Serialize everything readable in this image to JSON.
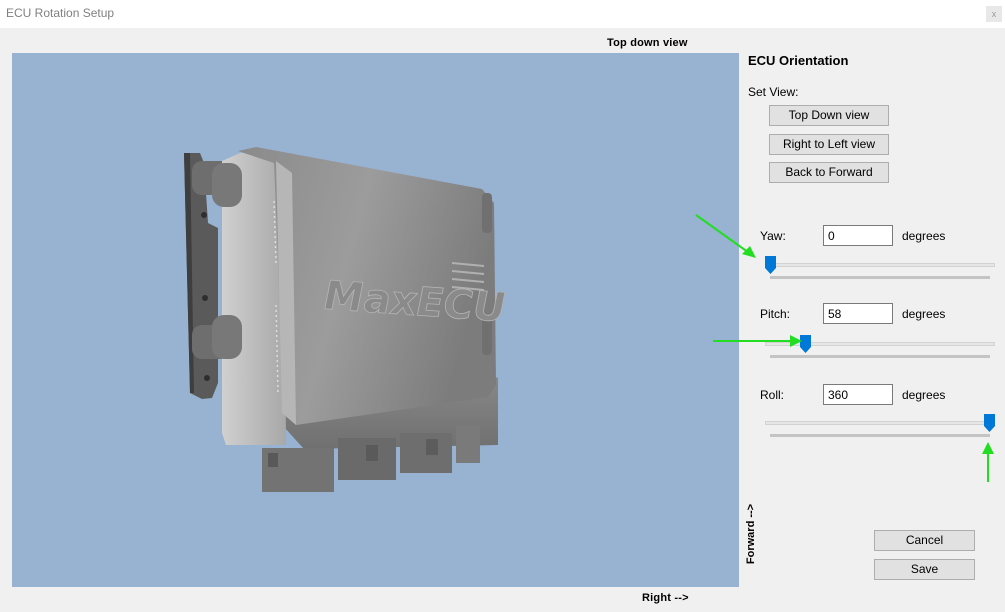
{
  "window": {
    "title": "ECU Rotation Setup",
    "close_glyph": "x"
  },
  "viewport": {
    "top_label": "Top down view",
    "bottom_label": "Right -->",
    "side_label": "Forward -->",
    "background_color": "#98b2d2",
    "logo_text": "MaxECU"
  },
  "panel": {
    "heading": "ECU Orientation",
    "set_view_label": "Set View:",
    "buttons": {
      "top_down": "Top Down view",
      "right_to_left": "Right to Left view",
      "back_to_forward": "Back to Forward"
    },
    "yaw": {
      "label": "Yaw:",
      "value": "0",
      "unit": "degrees",
      "slider_fraction": 0.0
    },
    "pitch": {
      "label": "Pitch:",
      "value": "58",
      "unit": "degrees",
      "slider_fraction": 0.161
    },
    "roll": {
      "label": "Roll:",
      "value": "360",
      "unit": "degrees",
      "slider_fraction": 1.0
    }
  },
  "footer": {
    "cancel_label": "Cancel",
    "save_label": "Save"
  },
  "colors": {
    "slider_thumb": "#0078d7",
    "annotation_arrow": "#22dd22"
  }
}
